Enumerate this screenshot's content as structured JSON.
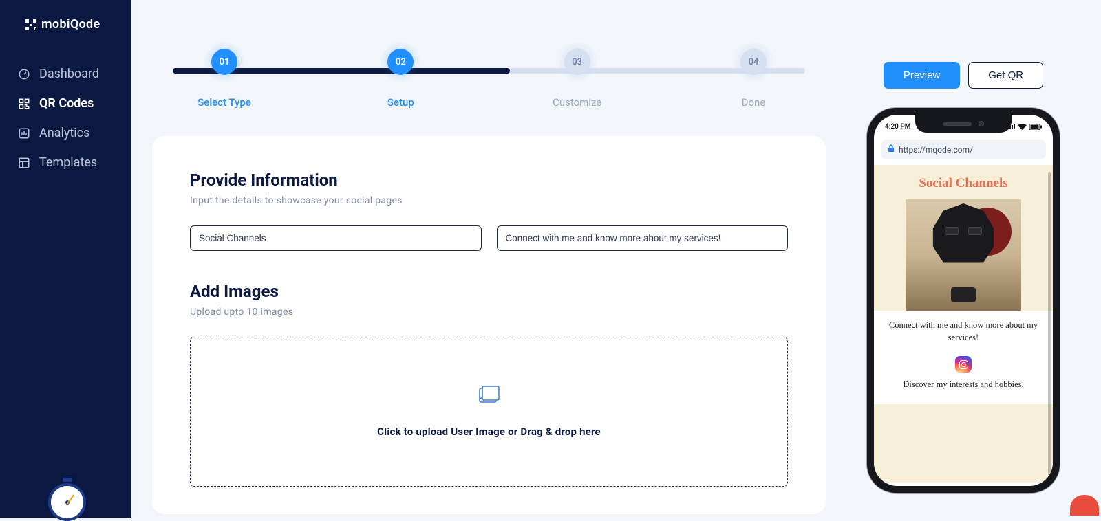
{
  "brand": {
    "name": "mobiQode"
  },
  "sidebar": {
    "items": [
      {
        "label": "Dashboard"
      },
      {
        "label": "QR Codes"
      },
      {
        "label": "Analytics"
      },
      {
        "label": "Templates"
      }
    ]
  },
  "stepper": {
    "steps": [
      {
        "num": "01",
        "label": "Select Type",
        "active": true
      },
      {
        "num": "02",
        "label": "Setup",
        "active": true
      },
      {
        "num": "03",
        "label": "Customize",
        "active": false
      },
      {
        "num": "04",
        "label": "Done",
        "active": false
      }
    ]
  },
  "form": {
    "section1_title": "Provide Information",
    "section1_sub": "Input the details to showcase your social pages",
    "title_value": "Social Channels",
    "desc_value": "Connect with me and know more about my services!",
    "section2_title": "Add Images",
    "section2_sub": "Upload upto 10 images",
    "dropzone_text": "Click to upload User Image or Drag & drop here"
  },
  "actions": {
    "preview": "Preview",
    "getqr": "Get QR"
  },
  "phone": {
    "time": "4:20 PM",
    "url": "https://mqode.com/",
    "headline": "Social Channels",
    "description": "Connect with me and know more about my services!",
    "ig_caption": "Discover my interests and hobbies."
  }
}
